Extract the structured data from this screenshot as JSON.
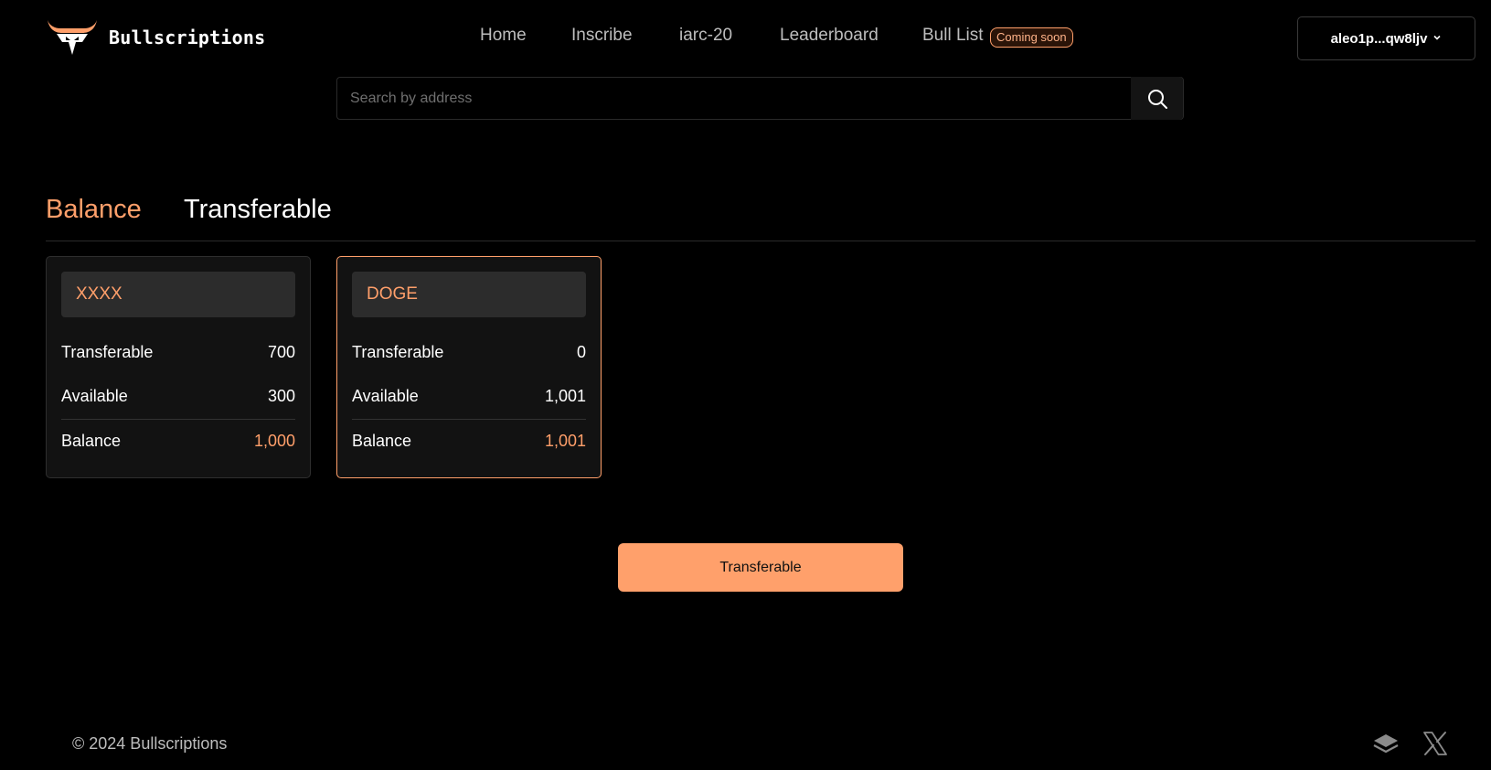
{
  "header": {
    "brand": "Bullscriptions",
    "nav": [
      "Home",
      "Inscribe",
      "iarc-20",
      "Leaderboard",
      "Bull List"
    ],
    "badge": "Coming soon",
    "wallet": "aleo1p...qw8ljv",
    "wallet_icon": "chevron-down-icon"
  },
  "search": {
    "placeholder": "Search by address",
    "icon": "search-icon"
  },
  "tabs": [
    "Balance",
    "Transferable"
  ],
  "active_tab": "Balance",
  "cards": [
    {
      "ticker": "XXXX",
      "rows": [
        {
          "label": "Transferable",
          "value": "700"
        },
        {
          "label": "Available",
          "value": "300"
        },
        {
          "label": "Balance",
          "value": "1,000"
        }
      ]
    },
    {
      "ticker": "DOGE",
      "rows": [
        {
          "label": "Transferable",
          "value": "0"
        },
        {
          "label": "Available",
          "value": "1,001"
        },
        {
          "label": "Balance",
          "value": "1,001"
        }
      ]
    }
  ],
  "selected_card": "DOGE",
  "action_button": "Transferable",
  "footer": {
    "copyright": "© 2024 Bullscriptions",
    "icons": [
      "layers-icon",
      "x-twitter-icon"
    ]
  },
  "colors": {
    "accent": "#ff9f6a",
    "background": "#000000",
    "card": "#121212"
  }
}
